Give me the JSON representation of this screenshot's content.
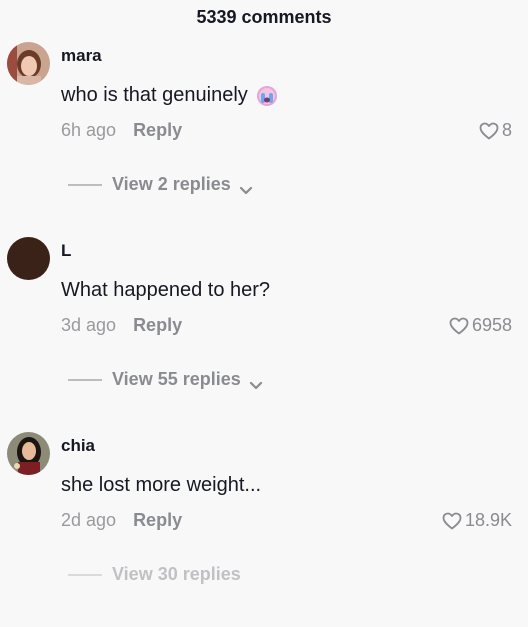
{
  "header": {
    "title": "5339 comments"
  },
  "comments": [
    {
      "username": "mara",
      "text": "who is that genuinely",
      "emoji": "crying-face-emoji",
      "time": "6h ago",
      "reply_label": "Reply",
      "likes": "8",
      "view_replies": "View 2 replies"
    },
    {
      "username": "L",
      "text": "What happened to her?",
      "time": "3d ago",
      "reply_label": "Reply",
      "likes": "6958",
      "view_replies": "View 55 replies"
    },
    {
      "username": "chia",
      "text": "she lost more weight...",
      "time": "2d ago",
      "reply_label": "Reply",
      "likes": "18.9K",
      "view_replies": "View 30 replies"
    }
  ],
  "icons": {
    "like": "heart-outline-icon",
    "expand": "chevron-down-icon"
  },
  "colors": {
    "background": "#f8f8f8",
    "text": "#161823",
    "muted": "#8a8b91",
    "avatar_L": "#3a2218"
  }
}
